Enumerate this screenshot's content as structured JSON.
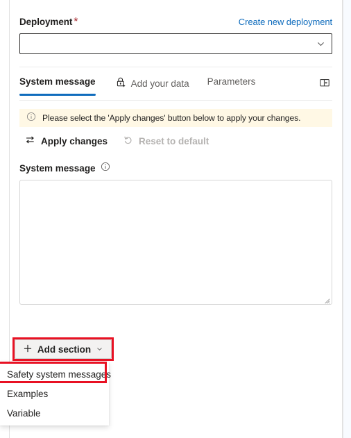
{
  "deployment": {
    "label": "Deployment",
    "required_marker": "*",
    "create_link": "Create new deployment",
    "selected_value": "",
    "chevron_icon": "chevron-down-icon"
  },
  "tabs": [
    {
      "label": "System message",
      "active": true,
      "icon": null
    },
    {
      "label": "Add your data",
      "active": false,
      "icon": "lock-icon"
    },
    {
      "label": "Parameters",
      "active": false,
      "icon": null
    }
  ],
  "panel_toggle": {
    "icon": "panel-collapse-icon",
    "tooltip": "Collapse panel"
  },
  "info_banner": {
    "icon": "info-circle-icon",
    "text": "Please select the 'Apply changes' button below to apply your changes."
  },
  "commands": [
    {
      "label": "Apply changes",
      "icon": "swap-arrows-icon",
      "disabled": false
    },
    {
      "label": "Reset to default",
      "icon": "undo-arrow-icon",
      "disabled": true
    }
  ],
  "system_message": {
    "label": "System message",
    "info_icon": "info-circle-icon",
    "value": "",
    "placeholder": ""
  },
  "add_section": {
    "label": "Add section",
    "plus_icon": "plus-icon",
    "chevron_icon": "chevron-down-icon"
  },
  "menu": {
    "items": [
      {
        "label": "Safety system messages",
        "highlighted": true
      },
      {
        "label": "Examples",
        "highlighted": false
      },
      {
        "label": "Variable",
        "highlighted": false
      }
    ]
  },
  "annotations": [
    {
      "name": "add-section-highlight",
      "color": "#e81123"
    },
    {
      "name": "safety-system-messages-highlight",
      "color": "#e81123"
    }
  ],
  "colors": {
    "accent": "#0f6cbd",
    "link": "#0f6cbd",
    "required": "#a4262c",
    "banner_bg": "#fff8e5",
    "annotation": "#e81123",
    "button_bg": "#f3f2f1"
  }
}
